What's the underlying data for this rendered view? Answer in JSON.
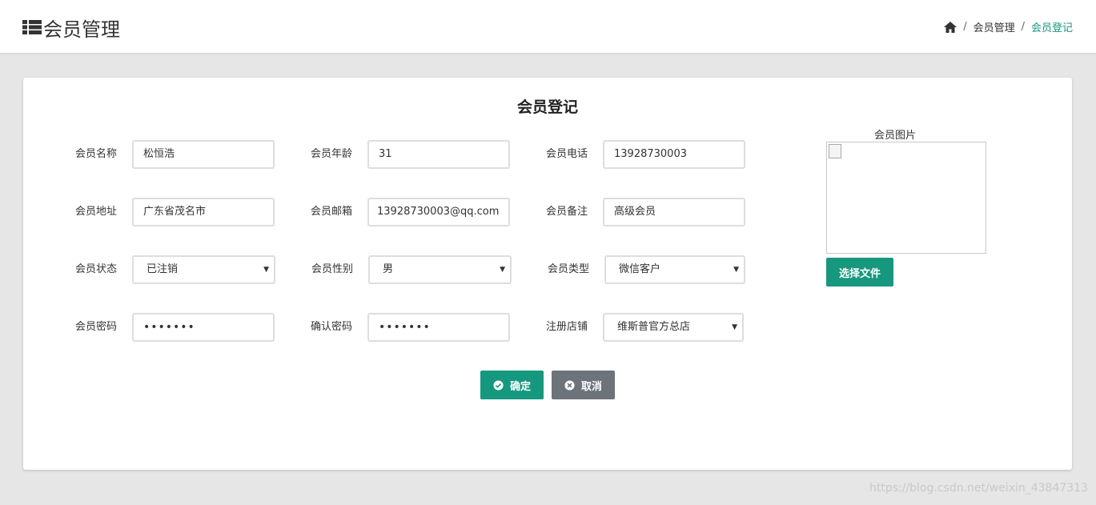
{
  "header": {
    "title": "会员管理",
    "breadcrumb": [
      "会员管理",
      "会员登记"
    ]
  },
  "form": {
    "title": "会员登记",
    "fields": {
      "name": {
        "label": "会员名称",
        "value": "松恒浩"
      },
      "age": {
        "label": "会员年龄",
        "value": "31"
      },
      "phone": {
        "label": "会员电话",
        "value": "13928730003"
      },
      "address": {
        "label": "会员地址",
        "value": "广东省茂名市"
      },
      "email": {
        "label": "会员邮箱",
        "value": "13928730003@qq.com"
      },
      "remark": {
        "label": "会员备注",
        "value": "高级会员"
      },
      "status": {
        "label": "会员状态",
        "value": "已注销"
      },
      "gender": {
        "label": "会员性别",
        "value": "男"
      },
      "type": {
        "label": "会员类型",
        "value": "微信客户"
      },
      "password": {
        "label": "会员密码",
        "value": "•••••••"
      },
      "confirm": {
        "label": "确认密码",
        "value": "•••••••"
      },
      "store": {
        "label": "注册店铺",
        "value": "维斯普官方总店"
      }
    },
    "image_label": "会员图片",
    "choose_file": "选择文件",
    "confirm_button": "确定",
    "cancel_button": "取消"
  },
  "watermark": "https://blog.csdn.net/weixin_43847313",
  "colors": {
    "accent": "#16987e",
    "cancel": "#6c737a",
    "background": "#e6e6e6"
  }
}
